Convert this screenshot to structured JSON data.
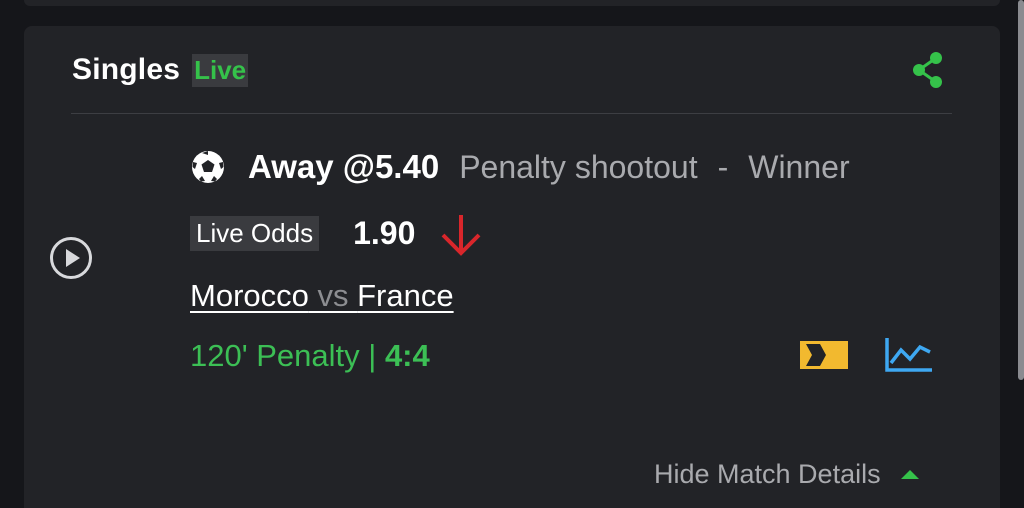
{
  "header": {
    "title": "Singles",
    "live_badge": "Live"
  },
  "bet": {
    "selection": "Away @5.40",
    "market": "Penalty shootout",
    "separator": "-",
    "market_type": "Winner",
    "odds_label": "Live Odds",
    "odds_value": "1.90",
    "odds_trend": "down"
  },
  "match": {
    "home_team": "Morocco",
    "vs": "vs",
    "away_team": "France",
    "status": "120' Penalty | ",
    "score": "4:4"
  },
  "footer": {
    "toggle_label": "Hide Match Details"
  },
  "icons": {
    "share": "share-icon",
    "play": "play-circle-icon",
    "sport": "soccer-ball-icon",
    "trend": "arrow-down-icon",
    "stream": "live-stream-icon",
    "stats": "stats-chart-icon",
    "collapse": "caret-up-icon"
  },
  "colors": {
    "background": "#15161a",
    "card": "#222327",
    "live_green": "#35c24a",
    "odds_down_red": "#d9262b",
    "stream_yellow": "#f2b92f",
    "stats_blue": "#3ea8f2",
    "muted_text": "#a9aaae"
  }
}
